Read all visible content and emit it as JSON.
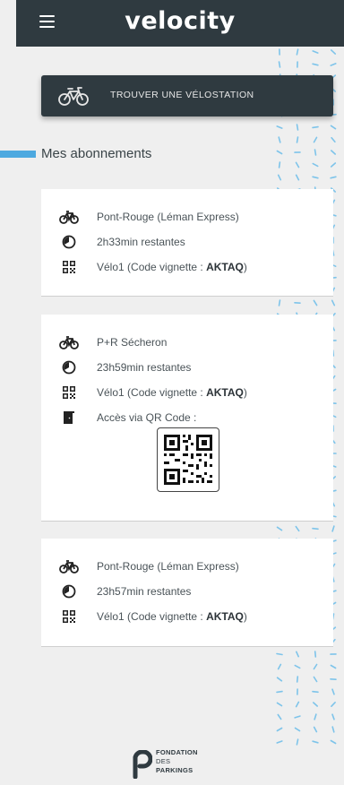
{
  "header": {
    "logo_text": "velocity"
  },
  "find_button": {
    "label": "TROUVER UNE VÉLOSTATION"
  },
  "section": {
    "title": "Mes abonnements"
  },
  "cards": [
    {
      "station": "Pont-Rouge (Léman Express)",
      "remaining": "2h33min restantes",
      "vignette_prefix": "Vélo1 (Code vignette : ",
      "vignette_code": "AKTAQ",
      "vignette_suffix": ")"
    },
    {
      "station": "P+R Sécheron",
      "remaining": "23h59min restantes",
      "vignette_prefix": "Vélo1 (Code vignette : ",
      "vignette_code": "AKTAQ",
      "vignette_suffix": ")",
      "access": "Accès via QR Code :"
    },
    {
      "station": "Pont-Rouge (Léman Express)",
      "remaining": "23h57min restantes",
      "vignette_prefix": "Vélo1 (Code vignette : ",
      "vignette_code": "AKTAQ",
      "vignette_suffix": ")"
    }
  ],
  "footer": {
    "line1": "FONDATION",
    "line2": "DES",
    "line3": "PARKINGS"
  },
  "icons": {
    "menu": "menu-icon",
    "bike": "bike-icon",
    "timer": "timer-icon",
    "qr": "qr-code-icon",
    "door": "door-icon"
  },
  "colors": {
    "header_bg": "#2f3a40",
    "accent": "#4da9e0",
    "page_bg": "#efefef",
    "card_bg": "#ffffff"
  }
}
